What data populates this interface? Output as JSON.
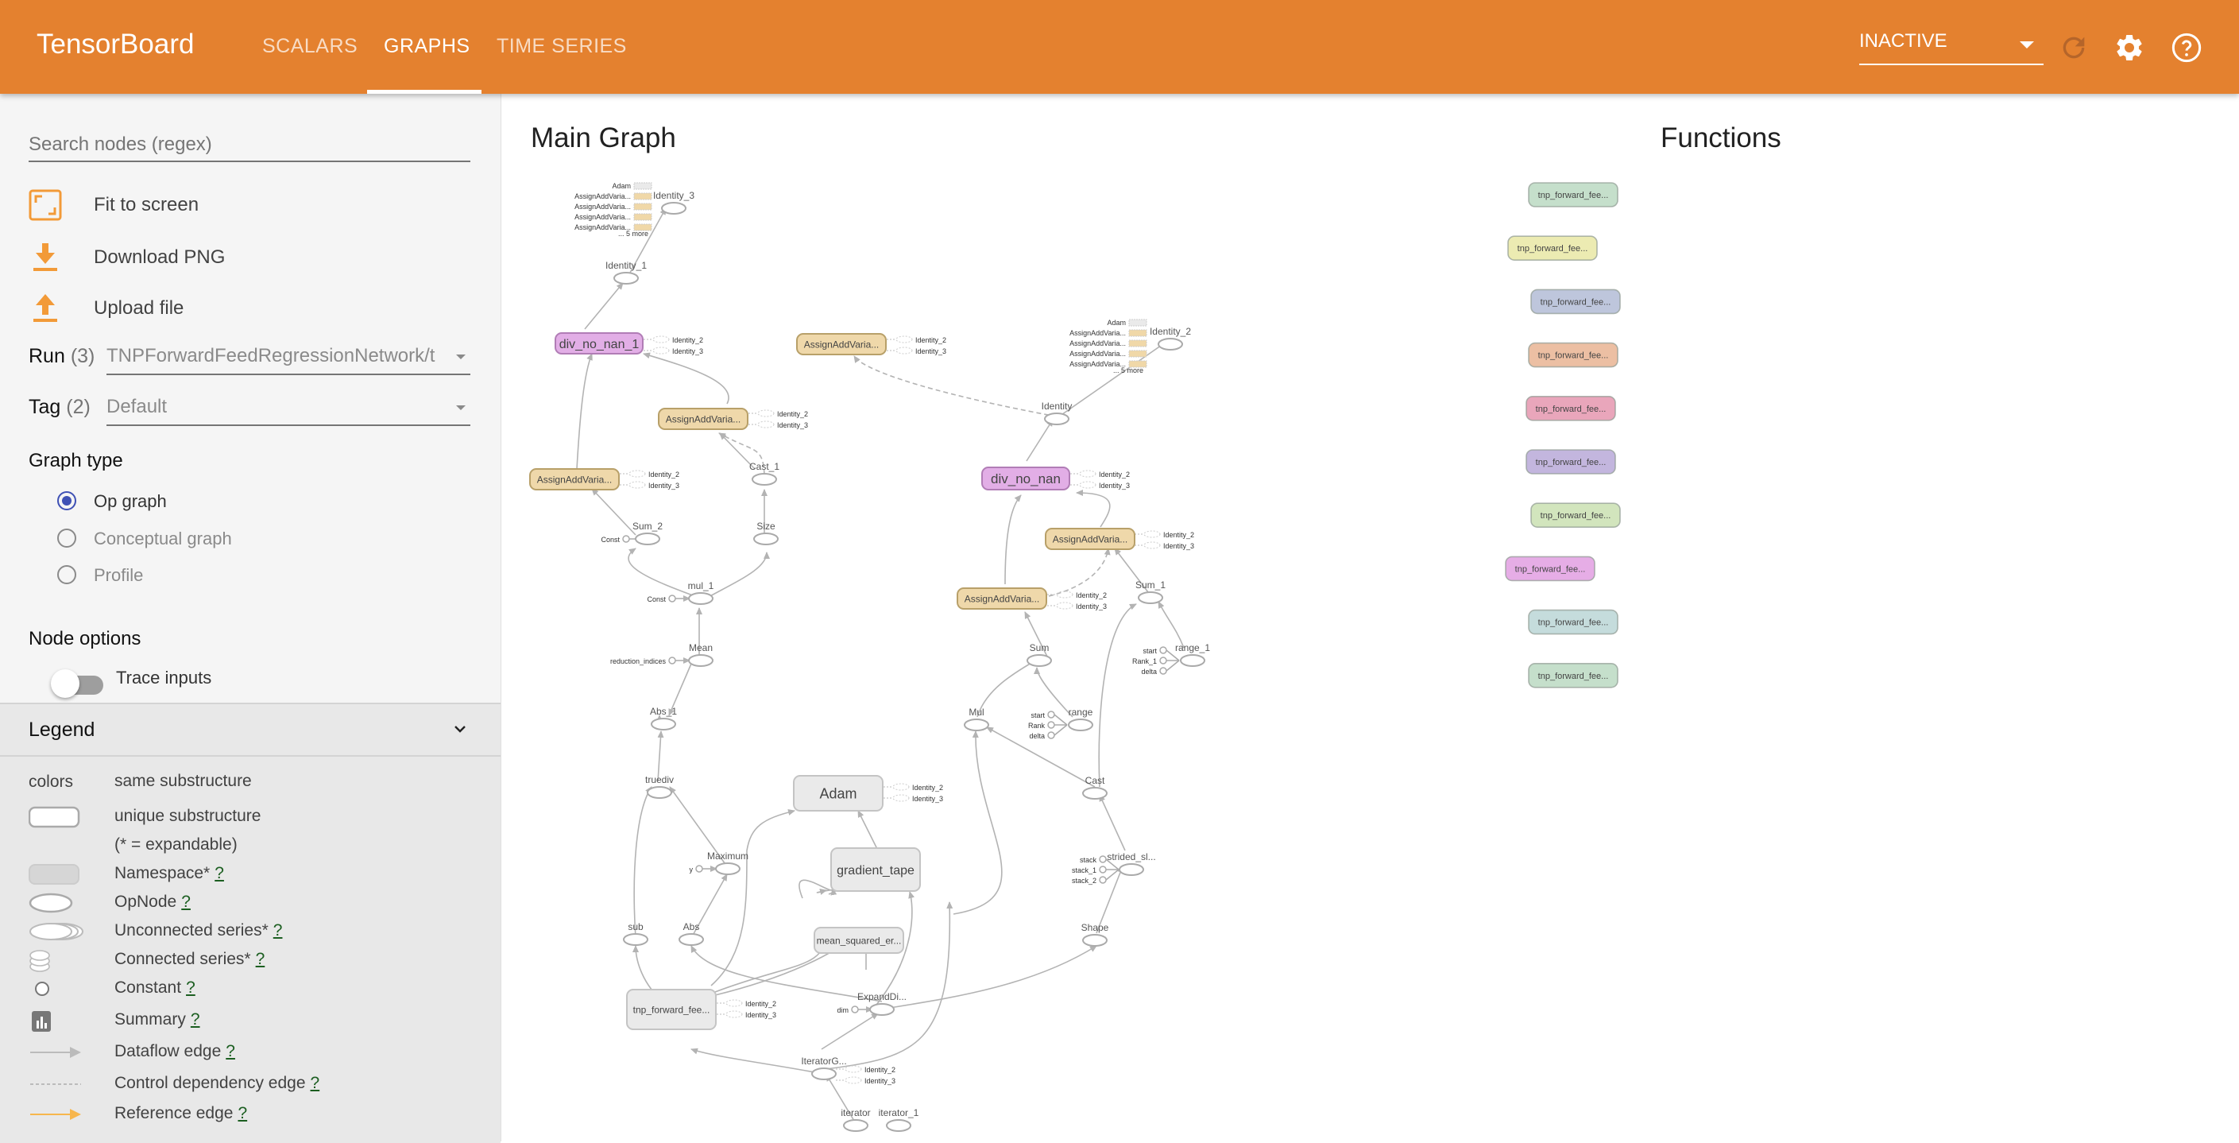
{
  "header": {
    "brand": "TensorBoard",
    "tabs": [
      {
        "label": "SCALARS",
        "active": false
      },
      {
        "label": "GRAPHS",
        "active": true
      },
      {
        "label": "TIME SERIES",
        "active": false
      }
    ],
    "run_selector": "INACTIVE",
    "icons": [
      "refresh-icon",
      "settings-icon",
      "help-icon"
    ],
    "color": "#E4812F"
  },
  "sidebar": {
    "search_placeholder": "Search nodes (regex)",
    "actions": [
      {
        "label": "Fit to screen",
        "icon": "fit-screen-icon"
      },
      {
        "label": "Download PNG",
        "icon": "download-icon"
      },
      {
        "label": "Upload file",
        "icon": "upload-icon"
      }
    ],
    "run": {
      "label": "Run",
      "count": "(3)",
      "value": "TNPForwardFeedRegressionNetwork/t"
    },
    "tag": {
      "label": "Tag",
      "count": "(2)",
      "value": "Default"
    },
    "graph_type": {
      "title": "Graph type",
      "options": [
        {
          "label": "Op graph",
          "selected": true
        },
        {
          "label": "Conceptual graph",
          "selected": false
        },
        {
          "label": "Profile",
          "selected": false
        }
      ]
    },
    "node_options": {
      "title": "Node options",
      "trace_inputs_label": "Trace inputs",
      "trace_inputs_on": false
    },
    "legend": {
      "title": "Legend",
      "rows": [
        {
          "symbol": "colors",
          "label": "same substructure",
          "help": ""
        },
        {
          "symbol": "unique-substructure",
          "label": "unique substructure",
          "help": ""
        },
        {
          "symbol": "",
          "label": "(* = expandable)",
          "help": ""
        },
        {
          "symbol": "namespace",
          "label": "Namespace*",
          "help": "?"
        },
        {
          "symbol": "opnode",
          "label": "OpNode",
          "help": "?"
        },
        {
          "symbol": "unconnected-series",
          "label": "Unconnected series*",
          "help": "?"
        },
        {
          "symbol": "connected-series",
          "label": "Connected series*",
          "help": "?"
        },
        {
          "symbol": "constant",
          "label": "Constant",
          "help": "?"
        },
        {
          "symbol": "summary",
          "label": "Summary",
          "help": "?"
        },
        {
          "symbol": "dataflow-edge",
          "label": "Dataflow edge",
          "help": "?"
        },
        {
          "symbol": "control-edge",
          "label": "Control dependency edge",
          "help": "?"
        },
        {
          "symbol": "reference-edge",
          "label": "Reference edge",
          "help": "?"
        }
      ]
    }
  },
  "main_graph": {
    "title": "Main Graph",
    "nodes": {
      "identity_3": "Identity_3",
      "identity_1": "Identity_1",
      "div_no_nan_1": "div_no_nan_1",
      "assign_a": "AssignAddVaria...",
      "assign_b": "AssignAddVaria...",
      "assign_c": "AssignAddVaria...",
      "cast_1": "Cast_1",
      "sum_2": "Sum_2",
      "size": "Size",
      "mul_1": "mul_1",
      "mean": "Mean",
      "abs_1": "Abs_1",
      "truediv": "truediv",
      "maximum": "Maximum",
      "sub": "sub",
      "abs": "Abs",
      "adam": "Adam",
      "gradient_tape": "gradient_tape",
      "mse": "mean_squared_er...",
      "tnp": "tnp_forward_fee...",
      "expand": "ExpandDi...",
      "iterator_g": "IteratorG...",
      "iterator": "iterator",
      "iterator_1": "iterator_1",
      "identity": "Identity",
      "identity_2": "Identity_2",
      "div_no_nan": "div_no_nan",
      "assign_d": "AssignAddVaria...",
      "assign_e": "AssignAddVaria...",
      "sum_1": "Sum_1",
      "range_1": "range_1",
      "sum": "Sum",
      "mul": "Mul",
      "range": "range",
      "cast": "Cast",
      "strided": "strided_sl...",
      "shape": "Shape"
    },
    "small_labels": {
      "identity_2": "Identity_2",
      "identity_3": "Identity_3",
      "const": "Const",
      "reduction_indices": "reduction_indices",
      "y": "y",
      "dim": "dim",
      "start": "start",
      "rank": "Rank",
      "rank_1": "Rank_1",
      "delta": "delta",
      "stack": "stack",
      "stack_1": "stack_1",
      "stack_2": "stack_2",
      "adam": "Adam",
      "assign": "AssignAddVaria...",
      "more": "... 5 more"
    }
  },
  "functions": {
    "title": "Functions",
    "items": [
      {
        "label": "tnp_forward_fee...",
        "color": "#c5dfcb"
      },
      {
        "label": "tnp_forward_fee...",
        "color": "#ecebb2"
      },
      {
        "label": "tnp_forward_fee...",
        "color": "#bec6dc"
      },
      {
        "label": "tnp_forward_fee...",
        "color": "#ecbfa3"
      },
      {
        "label": "tnp_forward_fee...",
        "color": "#e9a6bb"
      },
      {
        "label": "tnp_forward_fee...",
        "color": "#c3b6de"
      },
      {
        "label": "tnp_forward_fee...",
        "color": "#d2e5bd"
      },
      {
        "label": "tnp_forward_fee...",
        "color": "#e6ade6"
      },
      {
        "label": "tnp_forward_fee...",
        "color": "#c5dcdc"
      },
      {
        "label": "tnp_forward_fee...",
        "color": "#c5dfcb"
      }
    ]
  }
}
